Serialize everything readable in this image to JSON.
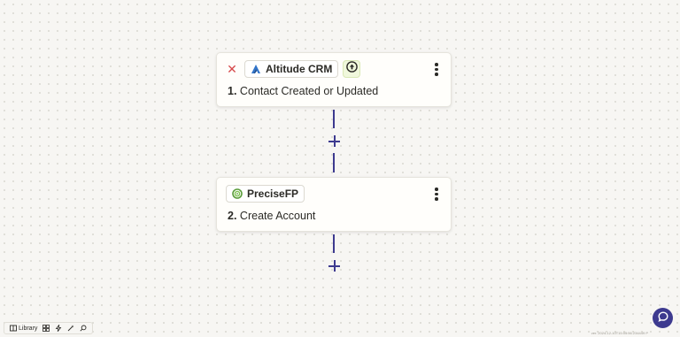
{
  "steps": [
    {
      "app_name": "Altitude CRM",
      "number": "1.",
      "title": "Contact Created or Updated",
      "icons": [
        "close-icon",
        "altitude-logo-icon",
        "upgrade-arrow-icon",
        "more-options-icon"
      ]
    },
    {
      "app_name": "PreciseFP",
      "number": "2.",
      "title": "Create Account",
      "icons": [
        "precisefp-logo-icon",
        "more-options-icon"
      ]
    }
  ],
  "toolbar": {
    "library_label": "Library",
    "icons": [
      "library-icon",
      "grid-icon",
      "bolt-icon",
      "wand-icon",
      "search-icon"
    ]
  },
  "version_text": "ver. 2024-12-10T15:05:56.234449 P",
  "colors": {
    "accent": "#3d3a8f",
    "close": "#d6494b",
    "altitude_blue": "#2f73c9",
    "precisefp_green": "#5a9c3a",
    "upgrade_bg": "#f0f8dc"
  }
}
